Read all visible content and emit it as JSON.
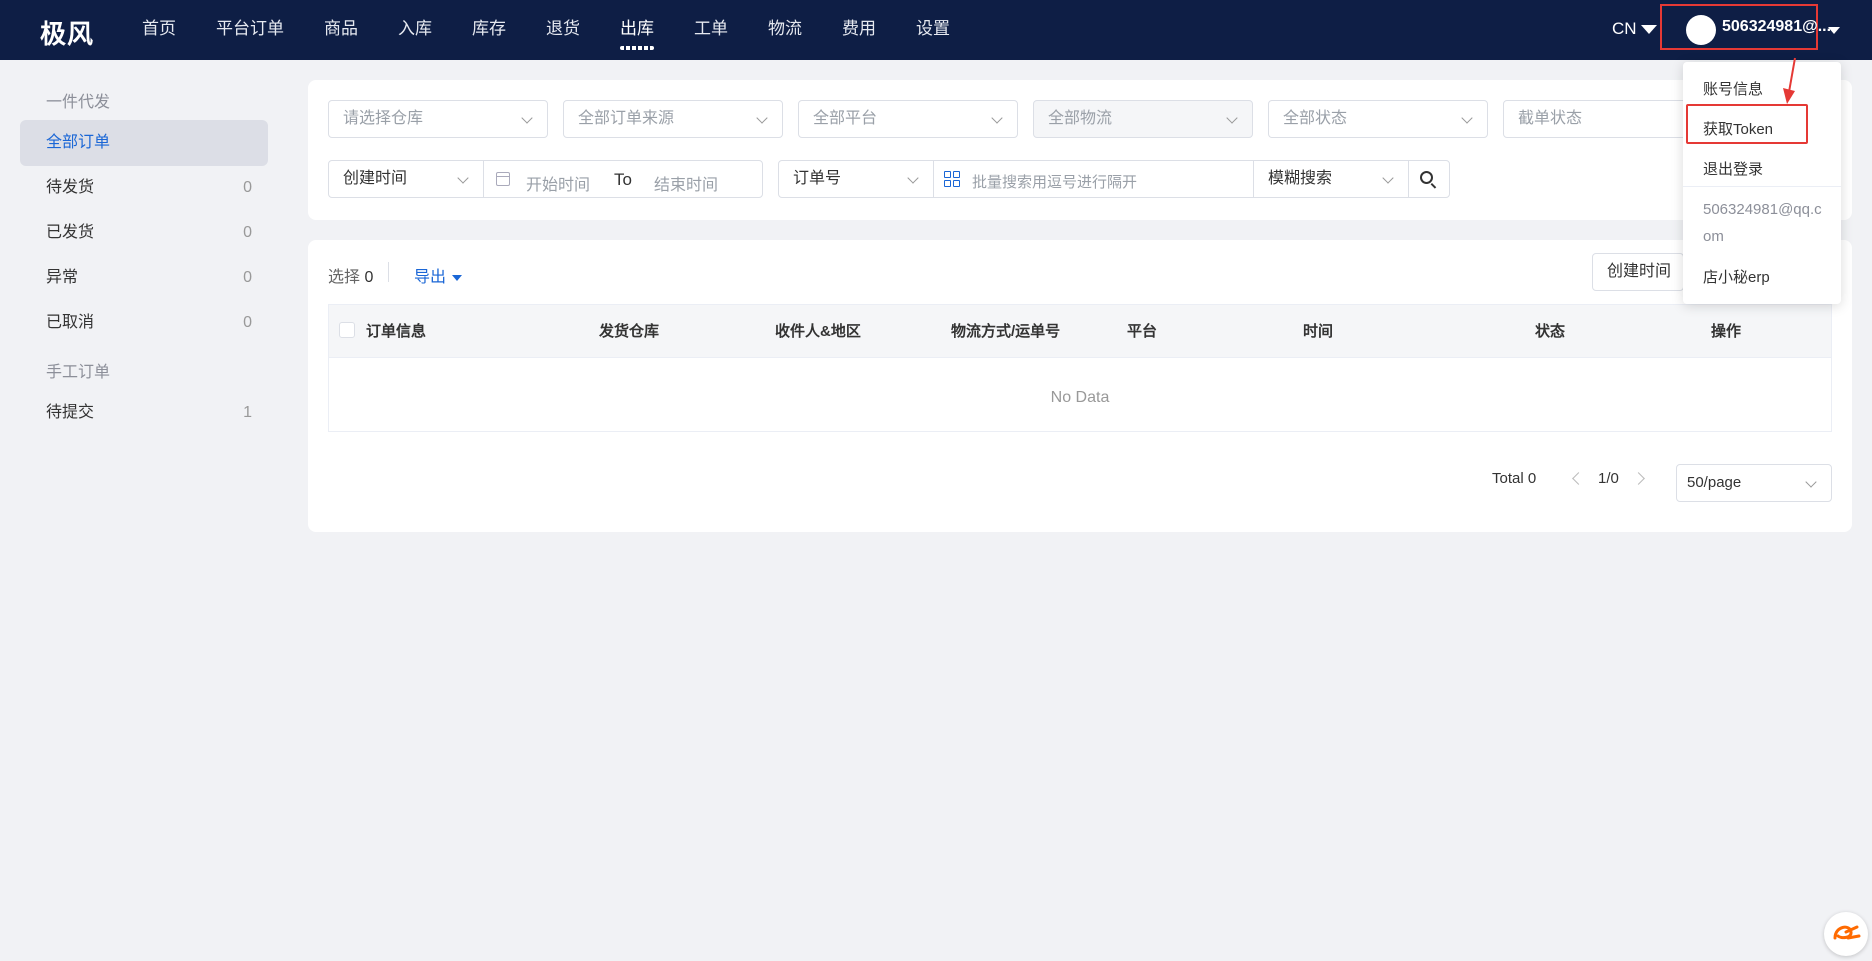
{
  "header": {
    "logo": "极风",
    "nav": [
      "首页",
      "平台订单",
      "商品",
      "入库",
      "库存",
      "退货",
      "出库",
      "工单",
      "物流",
      "费用",
      "设置"
    ],
    "active_nav": "出库",
    "lang": "CN",
    "username": "506324981@..."
  },
  "sidebar": {
    "group1": "一件代发",
    "items": [
      {
        "label": "全部订单",
        "count": ""
      },
      {
        "label": "待发货",
        "count": "0"
      },
      {
        "label": "已发货",
        "count": "0"
      },
      {
        "label": "异常",
        "count": "0"
      },
      {
        "label": "已取消",
        "count": "0"
      }
    ],
    "group2": "手工订单",
    "items2": [
      {
        "label": "待提交",
        "count": "1"
      }
    ]
  },
  "filters": {
    "warehouse": "请选择仓库",
    "order_source": "全部订单来源",
    "platform": "全部平台",
    "logistics": "全部物流",
    "status": "全部状态",
    "cutoff_status": "截单状态",
    "time_type": "创建时间",
    "start_time": "开始时间",
    "to": "To",
    "end_time": "结束时间",
    "search_field": "订单号",
    "search_placeholder": "批量搜索用逗号进行隔开",
    "match_mode": "模糊搜索"
  },
  "toolbar": {
    "selected_label": "选择",
    "selected_count": "0",
    "export": "导出",
    "sort": "创建时间"
  },
  "table": {
    "columns": [
      "订单信息",
      "发货仓库",
      "收件人&地区",
      "物流方式/运单号",
      "平台",
      "时间",
      "状态",
      "操作"
    ],
    "empty": "No Data"
  },
  "pagination": {
    "total": "Total 0",
    "page": "1/0",
    "page_size": "50/page"
  },
  "user_menu": {
    "account_info": "账号信息",
    "get_token": "获取Token",
    "logout": "退出登录",
    "email": "506324981@qq.com",
    "shop": "店小秘erp"
  },
  "colors": {
    "header_bg": "#0e1e45",
    "accent": "#1a66d6",
    "highlight": "#e53935"
  }
}
